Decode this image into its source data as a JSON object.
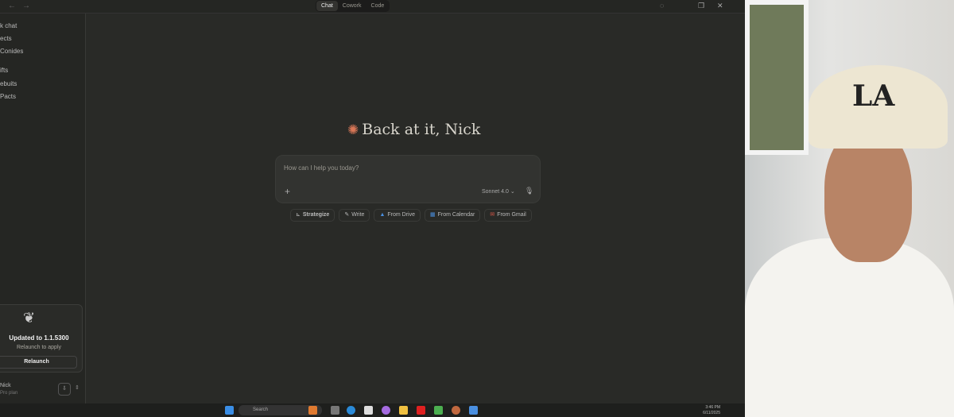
{
  "topbar": {
    "back": "←",
    "forward": "→",
    "modes": [
      "Chat",
      "Cowork",
      "Code"
    ],
    "active_mode": "Chat"
  },
  "sidebar": {
    "items": [
      "k chat",
      "ects",
      "Conides",
      "ifts",
      "ebuits",
      "Pacts"
    ],
    "update_card": {
      "title": "Updated to 1.1.5300",
      "subtitle": "Relaunch to apply",
      "button": "Relaunch"
    },
    "user": {
      "name": "Nick",
      "plan": "Pro plan"
    }
  },
  "main": {
    "greeting": "Back at it, Nick",
    "input_placeholder": "How can I help you today?",
    "model": "Sonnet 4.0",
    "chips": [
      {
        "icon": "strategize-icon",
        "label": "Strategize"
      },
      {
        "icon": "pen-icon",
        "label": "Write"
      },
      {
        "icon": "drive-icon",
        "label": "From Drive"
      },
      {
        "icon": "calendar-icon",
        "label": "From Calendar"
      },
      {
        "icon": "gmail-icon",
        "label": "From Gmail"
      }
    ]
  },
  "taskbar": {
    "search": "Search",
    "time": "3:46 PM",
    "date": "6/11/2025"
  }
}
